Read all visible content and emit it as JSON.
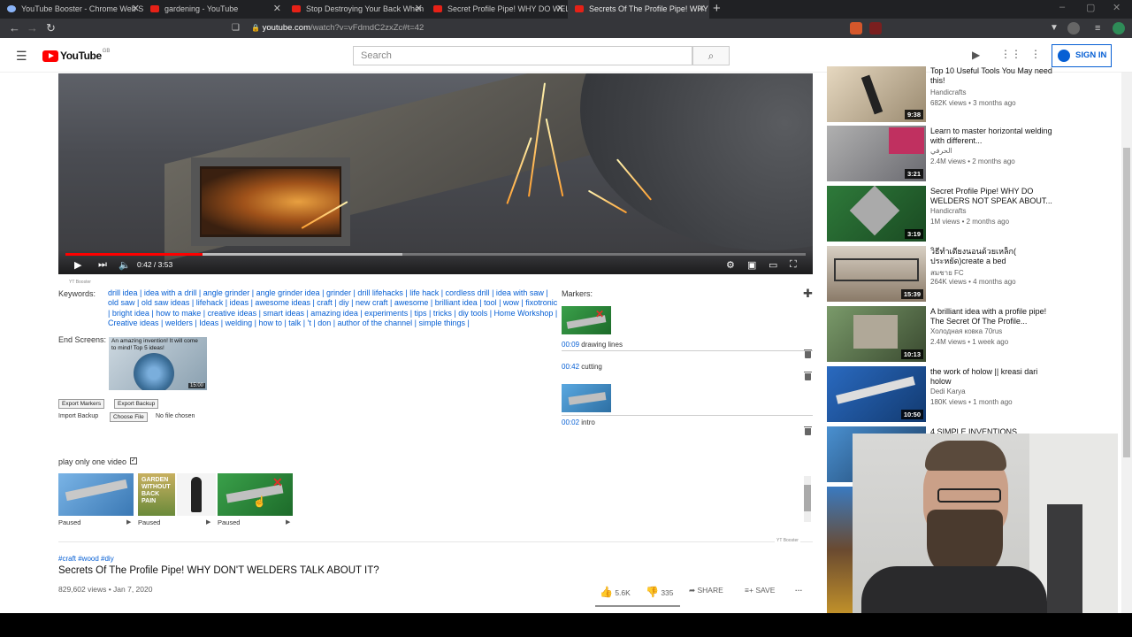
{
  "browser": {
    "tabs": [
      {
        "title": "YouTube Booster - Chrome Web S",
        "active": false
      },
      {
        "title": "gardening - YouTube",
        "active": false
      },
      {
        "title": "Stop Destroying Your Back When",
        "active": false
      },
      {
        "title": "Secret Profile Pipe! WHY DO WEL",
        "active": false
      },
      {
        "title": "Secrets Of The Profile Pipe! WHY D",
        "active": true
      }
    ],
    "url_host": "youtube.com",
    "url_rest": "/watch?v=vFdmdC2zxZc#t=42"
  },
  "header": {
    "logo_text": "YouTube",
    "region": "GB",
    "search_placeholder": "Search",
    "signin_label": "SIGN IN"
  },
  "player": {
    "time": "0:42 / 3:53",
    "progress": 0.185
  },
  "booster": {
    "brand": "YT Booster",
    "keywords_label": "Keywords:",
    "keywords": "drill idea | idea with a drill | angle grinder | angle grinder idea | grinder | drill lifehacks | life hack | cordless drill | idea with saw | old saw | old saw ideas | lifehack | ideas | awesome ideas | craft | diy | new craft | awesome | brilliant idea | tool | wow | fixotronic | bright idea | how to make | creative ideas | smart ideas | amazing idea | experiments | tips | tricks | diy tools | Home Workshop | Creative ideas | welders | Ideas | welding | how to | talk | 't | don | author of the channel | simple things |",
    "end_screens_label": "End Screens:",
    "end_screen": {
      "caption": "An amazing invention! It will come to mind! Top 5 ideas!",
      "duration": "15:00"
    },
    "export_markers_label": "Export Markers",
    "export_backup_label": "Export Backup",
    "import_backup_label": "Import Backup",
    "choose_file_label": "Choose File",
    "no_file_label": "No file chosen",
    "markers_label": "Markers:",
    "markers": [
      {
        "time": "00:09",
        "label": "drawing lines"
      },
      {
        "time": "00:42",
        "label": "cutting"
      },
      {
        "time": "00:02",
        "label": "intro"
      }
    ],
    "play_only_one_label": "play only one video",
    "play_only_one_checked": true,
    "playlist": [
      {
        "state": "Paused"
      },
      {
        "state": "Paused"
      },
      {
        "state": "Paused"
      }
    ]
  },
  "video_info": {
    "tags": "#craft #wood #diy",
    "title": "Secrets Of The Profile Pipe! WHY DON'T WELDERS TALK ABOUT IT?",
    "meta": "829,602 views • Jan 7, 2020",
    "likes": "5.6K",
    "dislikes": "335",
    "share_label": "SHARE",
    "save_label": "SAVE"
  },
  "sidebar": {
    "items": [
      {
        "title": "Top 10 Useful Tools You May need this!",
        "channel": "Handicrafts",
        "views": "682K views • 3 months ago",
        "duration": "9:38"
      },
      {
        "title": "Learn to master horizontal welding with different...",
        "channel": "الحرفي",
        "views": "2.4M views • 2 months ago",
        "duration": "3:21"
      },
      {
        "title": "Secret Profile Pipe! WHY DO WELDERS NOT SPEAK ABOUT...",
        "channel": "Handicrafts",
        "views": "1M views • 2 months ago",
        "duration": "3:19"
      },
      {
        "title": "วิธีทำเตียงนอนด้วยเหล็ก( ประหยัด)create a bed",
        "channel": "สมชาย FC",
        "views": "264K views • 4 months ago",
        "duration": "15:39"
      },
      {
        "title": "A brilliant idea with a profile pipe! The Secret Of The Profile...",
        "channel": "Холодная ковка 70rus",
        "views": "2.4M views • 1 week ago",
        "duration": "10:13"
      },
      {
        "title": "the work of holow || kreasi dari holow",
        "channel": "Dedi Karya",
        "views": "180K views • 1 month ago",
        "duration": "10:50"
      },
      {
        "title": "4 SIMPLE INVENTIONS",
        "channel": "",
        "views": "",
        "duration": ""
      }
    ]
  },
  "colors": {
    "yt_red": "#ff0000",
    "link_blue": "#065fd4",
    "chrome_dark": "#202124"
  }
}
